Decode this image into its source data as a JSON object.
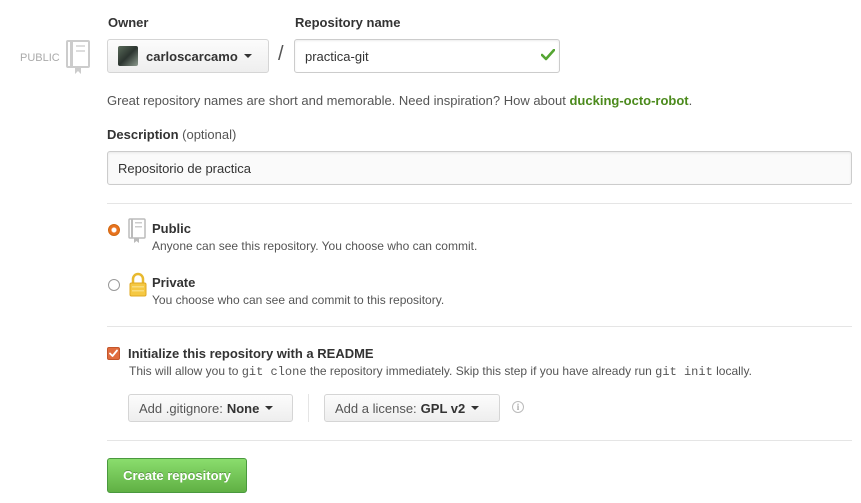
{
  "side": {
    "visibility_label": "PUBLIC",
    "repo_icon": "repo-book-icon"
  },
  "owner": {
    "label": "Owner",
    "name": "carloscarcamo",
    "avatar_icon": "avatar-image"
  },
  "separator": "/",
  "repo_name": {
    "label": "Repository name",
    "value": "practica-git",
    "valid_icon": "check-icon"
  },
  "hint": {
    "text": "Great repository names are short and memorable. Need inspiration? How about",
    "suggestion": "ducking-octo-robot",
    "end": "."
  },
  "description": {
    "label": "Description",
    "optional": "(optional)",
    "value": "Repositorio de practica"
  },
  "visibility": {
    "options": [
      {
        "title": "Public",
        "desc": "Anyone can see this repository. You choose who can commit.",
        "selected": true,
        "icon": "repo-book-icon"
      },
      {
        "title": "Private",
        "desc": "You choose who can see and commit to this repository.",
        "selected": false,
        "icon": "lock-icon"
      }
    ]
  },
  "readme": {
    "checked": true,
    "title": "Initialize this repository with a README",
    "desc_part1": "This will allow you to",
    "desc_code1": "git clone",
    "desc_part2": "the repository immediately. Skip this step if you have already run",
    "desc_code2": "git init",
    "desc_part3": "locally."
  },
  "gitignore": {
    "label": "Add .gitignore:",
    "value": "None"
  },
  "license": {
    "label": "Add a license:",
    "value": "GPL v2",
    "info_icon": "info-icon"
  },
  "create_button": "Create repository",
  "colors": {
    "accent_green": "#60b044",
    "link_green": "#4b8a1c",
    "checkbox_orange": "#e06c3e",
    "radio_orange": "#e8721f"
  }
}
